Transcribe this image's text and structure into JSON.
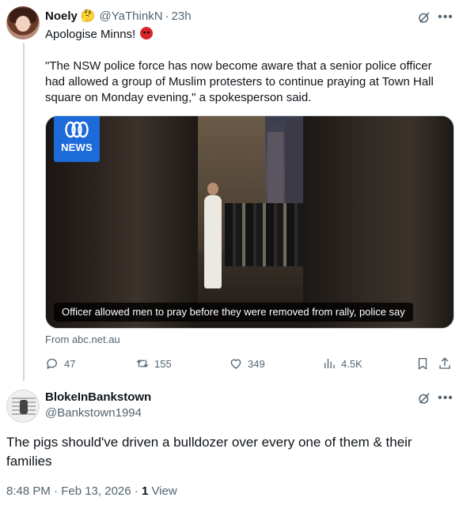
{
  "tweet": {
    "author_name": "Noely",
    "author_emoji": "🤔",
    "author_handle": "@YaThinkN",
    "separator": "·",
    "time": "23h",
    "text": "Apologise Minns!",
    "quote": "\"The NSW police force has now become aware that a senior police officer had allowed a group of Muslim protesters to continue praying at Town  Hall square on Monday evening,\" a spokesperson said.",
    "media": {
      "logo_text": "NEWS",
      "caption": "Officer allowed men to pray before they were removed from rally, police say"
    },
    "source": "From abc.net.au",
    "stats": {
      "replies": "47",
      "reposts": "155",
      "likes": "349",
      "views": "4.5K"
    }
  },
  "reply": {
    "author_name": "BlokeInBankstown",
    "author_handle": "@Bankstown1994",
    "text": "The pigs should've driven a bulldozer over every one of them & their families",
    "timestamp": "8:48 PM · Feb 13, 2026 · ",
    "view_count": "1",
    "view_label": " View"
  },
  "icons": [
    "grok-icon",
    "more-icon",
    "reply-icon",
    "repost-icon",
    "like-icon",
    "views-icon",
    "bookmark-icon",
    "share-icon",
    "abc-logo"
  ],
  "colors": {
    "text": "#0f1419",
    "secondary": "#536471",
    "abc_blue": "#1d6bd9"
  }
}
